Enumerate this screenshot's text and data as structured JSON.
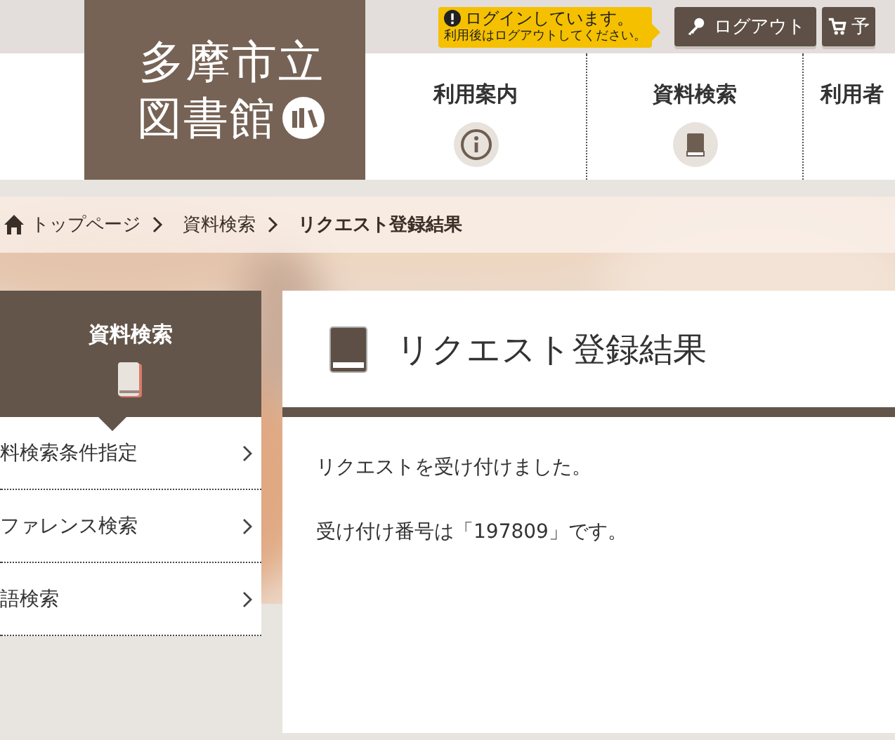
{
  "header": {
    "logo": {
      "line_1": "多摩市立",
      "line_2": "図書館"
    },
    "login_notice": {
      "title": "ログインしています。",
      "note": "利用後はログアウトしてください。"
    },
    "buttons": [
      {
        "kind": "logout",
        "label": "ログアウト"
      },
      {
        "kind": "cart",
        "label": "予"
      }
    ],
    "nav": [
      {
        "kind": "info",
        "label": "利用案内"
      },
      {
        "kind": "book",
        "label": "資料検索"
      },
      {
        "kind": "plain",
        "label": "利用者"
      }
    ]
  },
  "breadcrumb": [
    {
      "kind": "home",
      "label": "トップページ"
    },
    {
      "kind": "link",
      "label": "資料検索"
    },
    {
      "kind": "current",
      "label": "リクエスト登録結果"
    }
  ],
  "sidebar": {
    "title": "資料検索",
    "items": [
      {
        "label": "料検索条件指定"
      },
      {
        "label": "ファレンス検索"
      },
      {
        "label": "語検索"
      }
    ]
  },
  "main": {
    "title": "リクエスト登録結果",
    "paragraphs": [
      "リクエストを受け付けました。",
      "受け付け番号は「197809」です。"
    ]
  }
}
